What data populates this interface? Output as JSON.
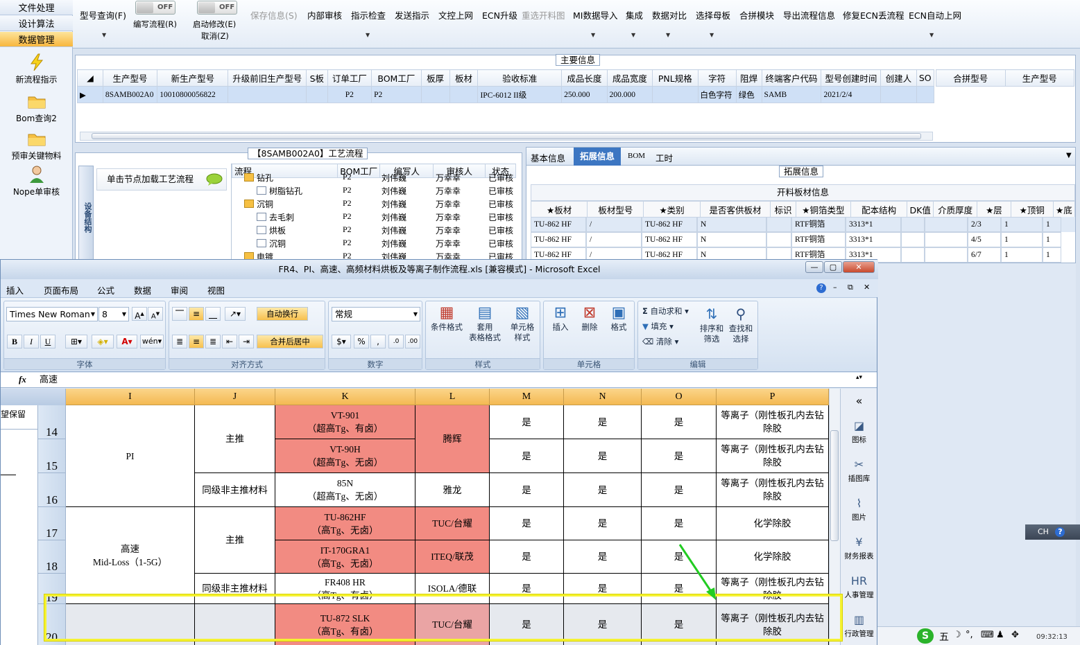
{
  "leftnav": {
    "tabs": [
      "文件处理",
      "设计算法",
      "数据管理"
    ],
    "items": [
      "新流程指示",
      "Bom查询2",
      "预审关键物料",
      "Nope单审核"
    ]
  },
  "toolbar": {
    "buttons": [
      "型号查询(F)",
      "保存信息(S)",
      "内部审核",
      "指示检查",
      "发送指示",
      "文控上网",
      "ECN升级",
      "重选开料图",
      "MI数据导入",
      "集成",
      "数据对比",
      "选择母板",
      "合拼模块",
      "导出流程信息",
      "修复ECN丢流程",
      "ECN自动上网"
    ],
    "toggle1": {
      "state": "OFF",
      "label": "编写流程(R)"
    },
    "toggle2": {
      "state": "OFF",
      "label": "启动修改(E)",
      "label2": "取消(Z)"
    }
  },
  "main_info": {
    "title": "主要信息",
    "columns": [
      "生产型号",
      "新生产型号",
      "升级前旧生产型号",
      "S板",
      "订单工厂",
      "BOM工厂",
      "板厚",
      "板材",
      "验收标准",
      "成品长度",
      "成品宽度",
      "PNL规格",
      "字符",
      "阻焊",
      "终端客户代码",
      "型号创建时间",
      "创建人",
      "SO"
    ],
    "row": [
      "8SAMB002A0",
      "10010800056822",
      "",
      "",
      "P2",
      "P2",
      "",
      "",
      "IPC-6012 II级",
      "250.000",
      "200.000",
      "",
      "白色字符",
      "绿色",
      "SAMB",
      "2021/2/4",
      "",
      ""
    ],
    "merge_columns": [
      "合拼型号",
      "生产型号"
    ]
  },
  "process": {
    "title": "【8SAMB002A0】工艺流程",
    "side_tab": "设备结构",
    "hint": "单击节点加载工艺流程",
    "columns": [
      "流程",
      "BOM工厂",
      "编写人",
      "审核人",
      "状态"
    ],
    "rows": [
      {
        "name": "钻孔",
        "factory": "P2",
        "writer": "刘伟巍",
        "reviewer": "万幸幸",
        "status": "已审核"
      },
      {
        "name": "树脂钻孔",
        "factory": "P2",
        "writer": "刘伟巍",
        "reviewer": "万幸幸",
        "status": "已审核"
      },
      {
        "name": "沉铜",
        "factory": "P2",
        "writer": "刘伟巍",
        "reviewer": "万幸幸",
        "status": "已审核"
      },
      {
        "name": "去毛刺",
        "factory": "P2",
        "writer": "刘伟巍",
        "reviewer": "万幸幸",
        "status": "已审核"
      },
      {
        "name": "烘板",
        "factory": "P2",
        "writer": "刘伟巍",
        "reviewer": "万幸幸",
        "status": "已审核"
      },
      {
        "name": "沉铜",
        "factory": "P2",
        "writer": "刘伟巍",
        "reviewer": "万幸幸",
        "status": "已审核"
      },
      {
        "name": "电镀",
        "factory": "P2",
        "writer": "刘伟巍",
        "reviewer": "万幸幸",
        "status": "已审核"
      }
    ]
  },
  "ext": {
    "tabs": [
      "基本信息",
      "拓展信息",
      "BOM",
      "工时"
    ],
    "title": "拓展信息",
    "table_title": "开料板材信息",
    "columns": [
      "★板材",
      "板材型号",
      "★类别",
      "是否客供板材",
      "标识",
      "★铜箔类型",
      "配本结构",
      "DK值",
      "介质厚度",
      "★层",
      "★顶铜",
      "★底"
    ],
    "rows": [
      [
        "TU-862 HF",
        "/",
        "TU-862 HF",
        "N",
        "",
        "RTF铜箔",
        "3313*1",
        "",
        "",
        "2/3",
        "1",
        "1"
      ],
      [
        "TU-862 HF",
        "/",
        "TU-862 HF",
        "N",
        "",
        "RTF铜箔",
        "3313*1",
        "",
        "",
        "4/5",
        "1",
        "1"
      ],
      [
        "TU-862 HF",
        "/",
        "TU-862 HF",
        "N",
        "",
        "RTF铜箔",
        "3313*1",
        "",
        "",
        "6/7",
        "1",
        "1"
      ]
    ]
  },
  "excel": {
    "title": "FR4、PI、高速、高频材料烘板及等离子制作流程.xls  [兼容模式] - Microsoft Excel",
    "menu": [
      "插入",
      "页面布局",
      "公式",
      "数据",
      "审阅",
      "视图"
    ],
    "font_name": "Times New Roman",
    "font_size": "8",
    "wrap_text": "自动换行",
    "merge_center": "合并后居中",
    "number_format": "常规",
    "groups": [
      "字体",
      "对齐方式",
      "数字",
      "样式",
      "单元格",
      "编辑"
    ],
    "style_buttons": [
      "条件格式",
      "套用\n表格格式",
      "单元格\n样式"
    ],
    "cell_buttons": [
      "插入",
      "删除",
      "格式"
    ],
    "edit_buttons": [
      "自动求和",
      "填充",
      "清除",
      "排序和\n筛选",
      "查找和\n选择"
    ],
    "formula_value": "高速",
    "left_partial": "望保留",
    "columns": [
      "I",
      "J",
      "K",
      "L",
      "M",
      "N",
      "O",
      "P"
    ],
    "rows": [
      "14",
      "15",
      "16",
      "17",
      "18",
      "19",
      "20"
    ],
    "cells": {
      "pi": "PI",
      "zhutui": "主推",
      "tongji": "同级非主推材料",
      "gaosu": "高速\nMid-Loss（1-5G）",
      "k14": "VT-901\n（超高Tg、有卤）",
      "k15": "VT-90H\n（超高Tg、无卤）",
      "k16": "85N\n（超高Tg、无卤）",
      "k17": "TU-862HF\n（高Tg、无卤）",
      "k18": "IT-170GRA1\n（高Tg、无卤）",
      "k19": "FR408 HR\n（高Tg、有卤）",
      "k20": "TU-872 SLK\n（高Tg、有卤）",
      "l14": "腾辉",
      "l16": "雅龙",
      "l17": "TUC/台耀",
      "l18": "ITEQ/联茂",
      "l19": "ISOLA/德联",
      "l20": "TUC/台耀",
      "yes": "是",
      "plasma": "等离子（刚性板孔内去钻除胶",
      "chem": "化学除胶"
    },
    "side": [
      "图标",
      "插图库",
      "图片",
      "财务报表",
      "人事管理",
      "行政管理"
    ]
  },
  "ime": {
    "label": "CH"
  },
  "tray": {
    "time": "09:32:13",
    "ime_glyph": "五"
  },
  "colors": {
    "highlight": "#f5f232",
    "arrow": "#22cc22",
    "red": "#f28b82",
    "selected_row": "#cfe0f6"
  }
}
